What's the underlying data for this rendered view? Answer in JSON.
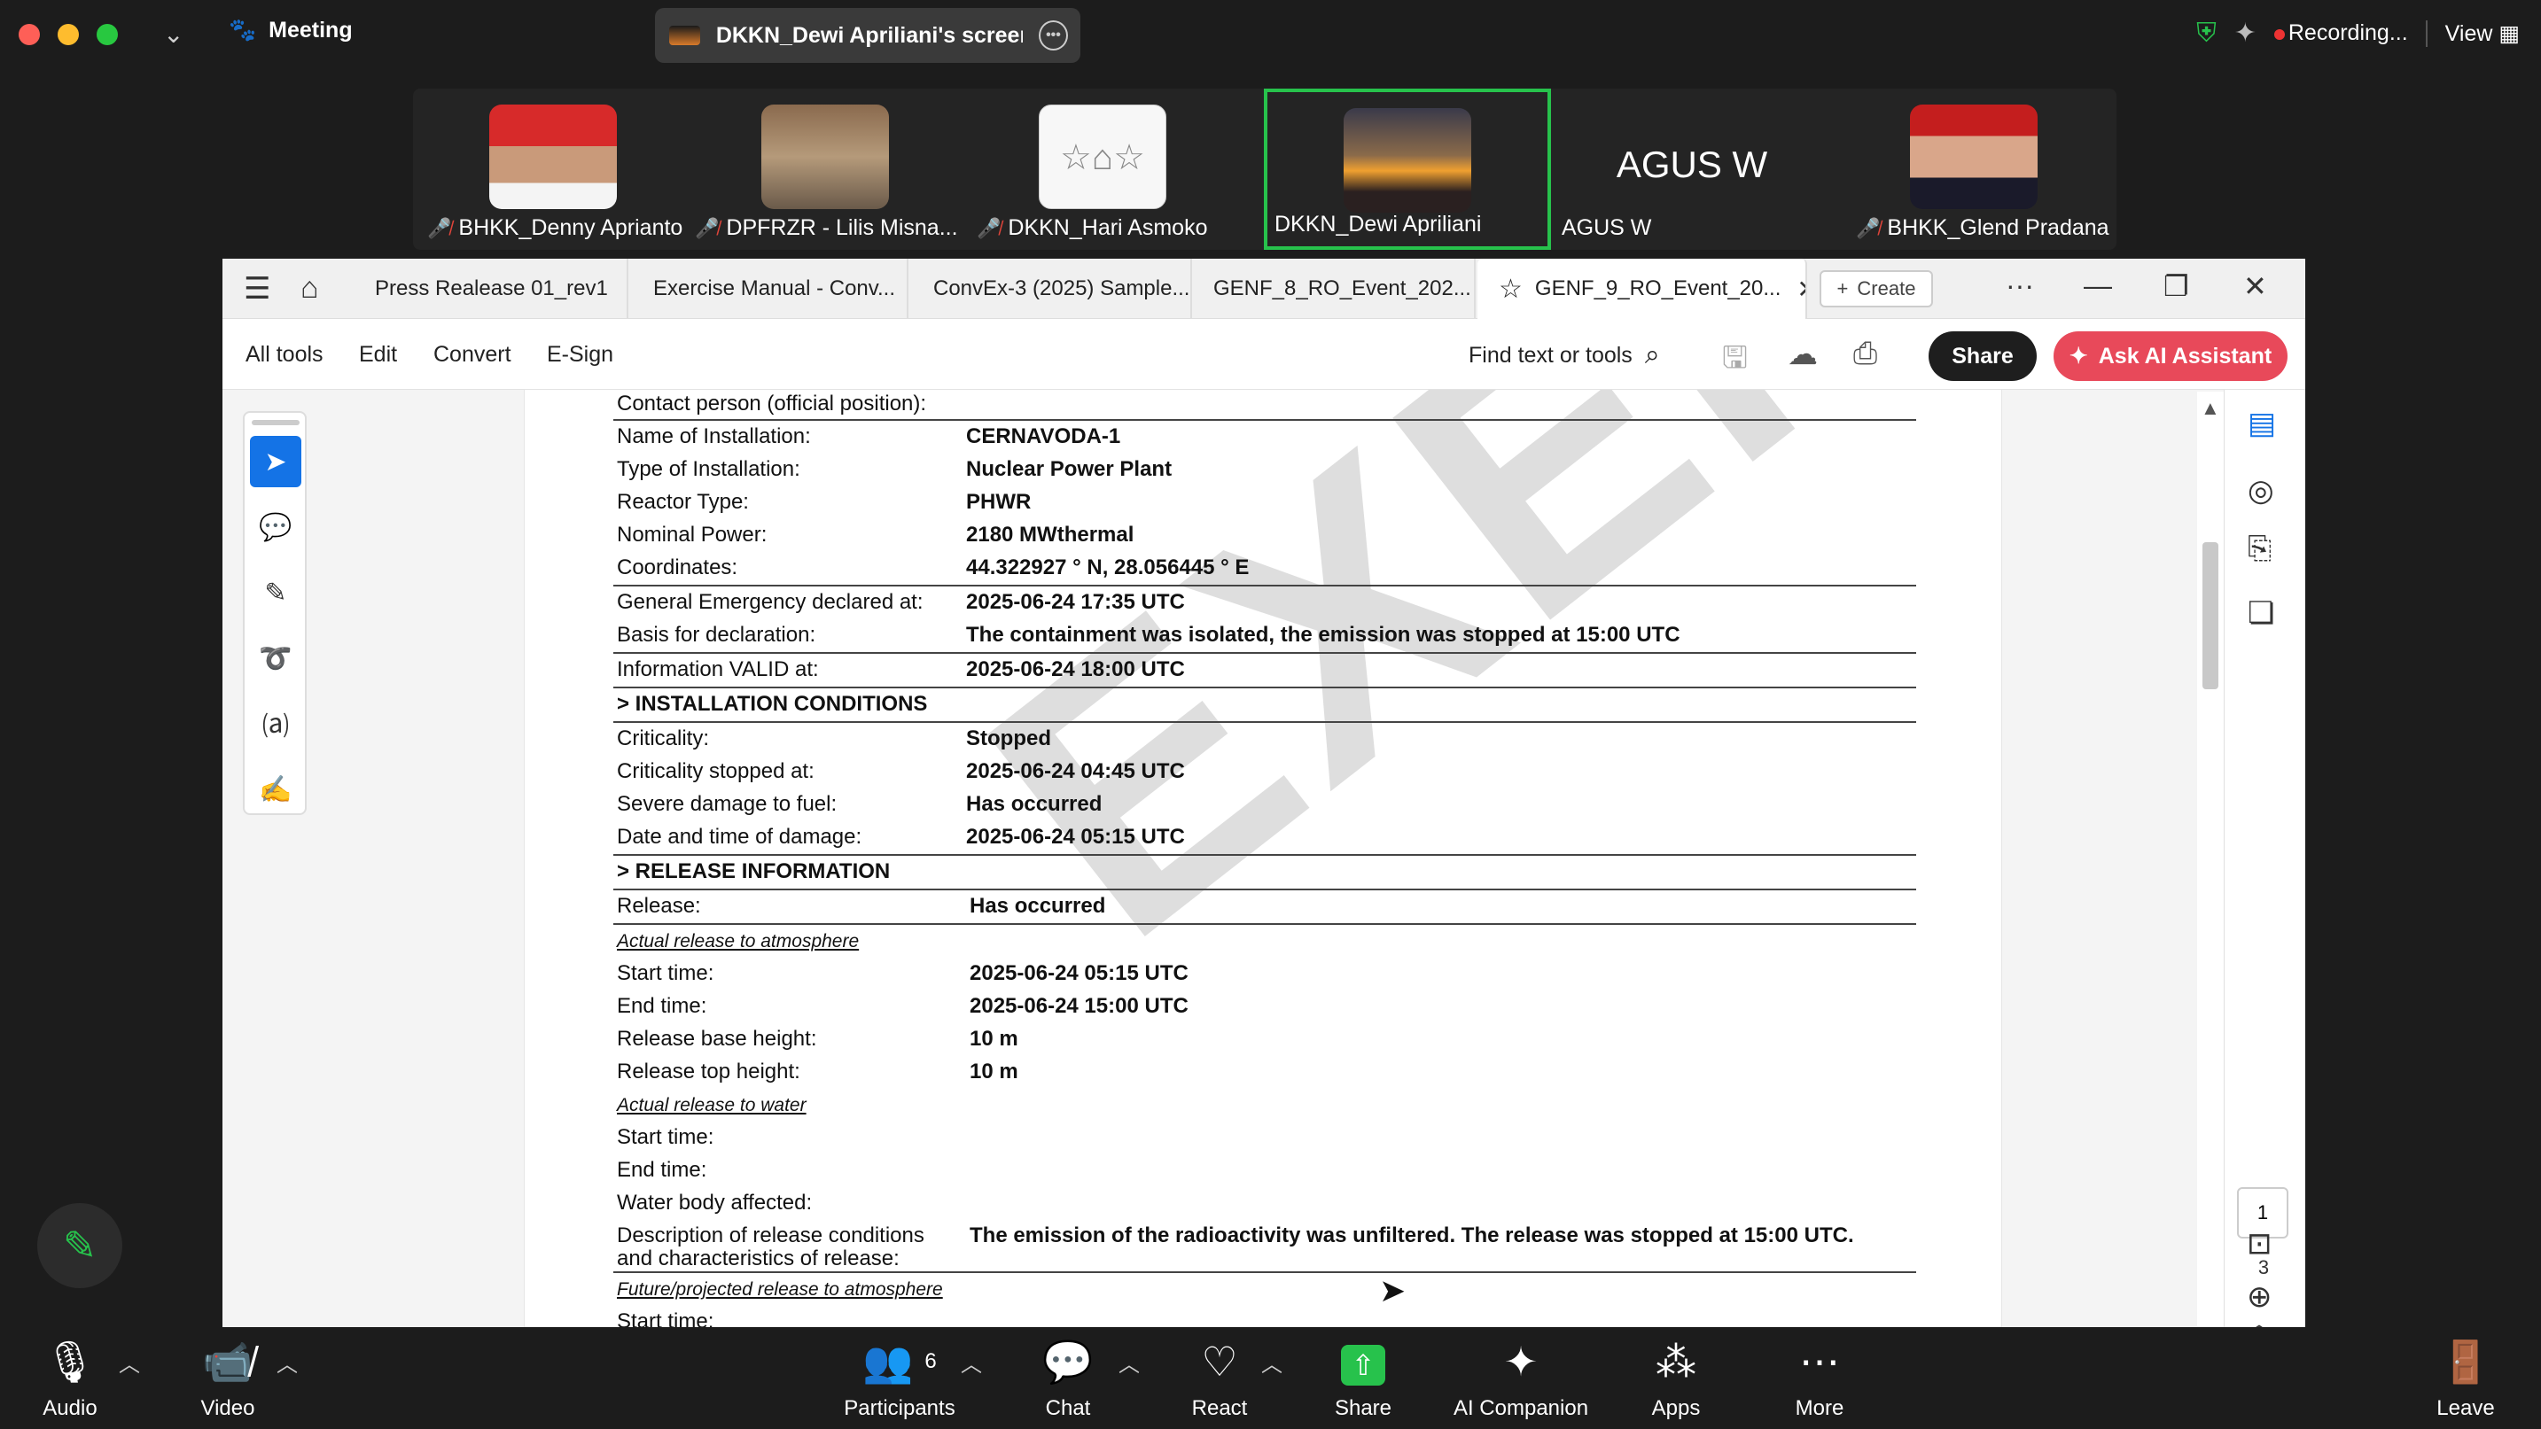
{
  "titlebar": {
    "meeting_label": "Meeting",
    "screen_share_label": "DKKN_Dewi Apriliani's screen",
    "recording_label": "Recording...",
    "view_label": "View"
  },
  "gallery": {
    "participants": [
      {
        "name": "BHKK_Denny Aprianto",
        "muted": true
      },
      {
        "name": "DPFRZR - Lilis Misna...",
        "muted": true
      },
      {
        "name": "DKKN_Hari Asmoko",
        "muted": true
      },
      {
        "name": "DKKN_Dewi Apriliani",
        "muted": false,
        "active": true
      },
      {
        "name": "AGUS W",
        "muted": false,
        "big_name": "AGUS W"
      },
      {
        "name": "BHKK_Glend Pradana",
        "muted": true
      }
    ]
  },
  "acrobat": {
    "tabs": [
      {
        "label": "Press Realease 01_rev1"
      },
      {
        "label": "Exercise Manual - Conv..."
      },
      {
        "label": "ConvEx-3 (2025) Sample..."
      },
      {
        "label": "GENF_8_RO_Event_202..."
      },
      {
        "label": "GENF_9_RO_Event_20..."
      }
    ],
    "create_label": "Create",
    "menu": {
      "all_tools": "All tools",
      "edit": "Edit",
      "convert": "Convert",
      "esign": "E-Sign"
    },
    "find_label": "Find text or tools",
    "share_label": "Share",
    "ai_label": "Ask AI Assistant",
    "current_page": "1",
    "page_count": "3"
  },
  "document": {
    "watermark": "EXERCISE",
    "contact": "Contact person (official position):",
    "installation": [
      {
        "label": "Name of Installation:",
        "value": "CERNAVODA-1"
      },
      {
        "label": "Type of Installation:",
        "value": "Nuclear Power Plant"
      },
      {
        "label": "Reactor Type:",
        "value": "PHWR"
      },
      {
        "label": "Nominal Power:",
        "value": "2180 MWthermal"
      },
      {
        "label": "Coordinates:",
        "value": "44.322927 ° N, 28.056445 ° E"
      }
    ],
    "declaration": [
      {
        "label": "General Emergency declared at:",
        "value": "2025-06-24 17:35 UTC"
      },
      {
        "label": "Basis for declaration:",
        "value": "The containment was isolated, the emission was stopped at 15:00 UTC"
      }
    ],
    "valid": {
      "label": "Information VALID at:",
      "value": "2025-06-24 18:00 UTC"
    },
    "conditions_heading": "> INSTALLATION CONDITIONS",
    "conditions": [
      {
        "label": "Criticality:",
        "value": "Stopped"
      },
      {
        "label": "Criticality stopped at:",
        "value": "2025-06-24 04:45 UTC"
      },
      {
        "label": "Severe damage to fuel:",
        "value": "Has occurred"
      },
      {
        "label": "Date and time of damage:",
        "value": "2025-06-24 05:15 UTC"
      }
    ],
    "release_heading": "> RELEASE INFORMATION",
    "release": {
      "label": "Release:",
      "value": "Has occurred"
    },
    "atmos_heading": "Actual release to atmosphere",
    "atmos": [
      {
        "label": "Start time:",
        "value": "2025-06-24 05:15 UTC"
      },
      {
        "label": "End time:",
        "value": "2025-06-24 15:00 UTC"
      },
      {
        "label": "Release base height:",
        "value": "10 m"
      },
      {
        "label": "Release top height:",
        "value": "10 m"
      }
    ],
    "water_heading": "Actual release to water",
    "water": [
      {
        "label": "Start time:",
        "value": ""
      },
      {
        "label": "End time:",
        "value": ""
      },
      {
        "label": "Water body affected:",
        "value": ""
      }
    ],
    "description": {
      "label_line1": "Description of release conditions",
      "label_line2": "and characteristics of release:",
      "value": "The emission of the radioactivity was unfiltered. The release was stopped at 15:00 UTC."
    },
    "future_heading": "Future/projected release to atmosphere",
    "future_start": "Start time:"
  },
  "bottombar": {
    "audio": "Audio",
    "video": "Video",
    "participants": "Participants",
    "participants_count": "6",
    "chat": "Chat",
    "react": "React",
    "share": "Share",
    "ai_companion": "AI Companion",
    "apps": "Apps",
    "more": "More",
    "leave": "Leave"
  }
}
